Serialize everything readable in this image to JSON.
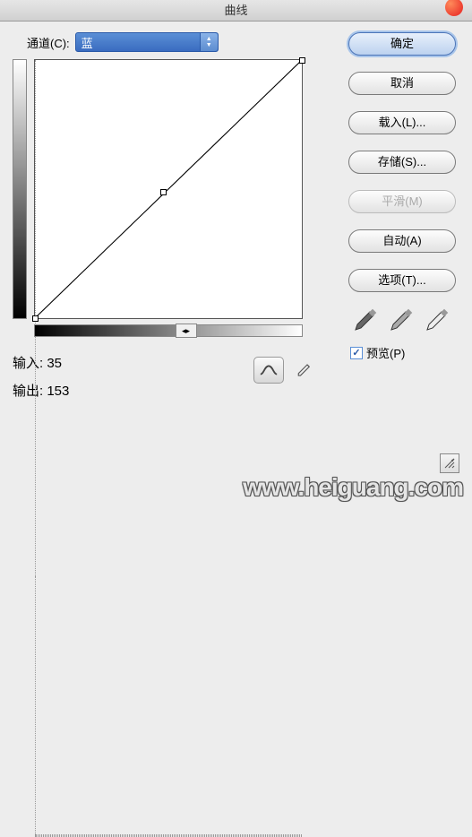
{
  "title": "曲线",
  "channel": {
    "label": "通道(C):",
    "value": "蓝"
  },
  "io": {
    "input_label": "输入:",
    "input_value": "35",
    "output_label": "输出:",
    "output_value": "153"
  },
  "buttons": {
    "ok": "确定",
    "cancel": "取消",
    "load": "载入(L)...",
    "save": "存储(S)...",
    "smooth": "平滑(M)",
    "auto": "自动(A)",
    "options": "选项(T)..."
  },
  "preview": {
    "label": "预览(P)",
    "checked": true
  },
  "hslider_glyph": "◂▸",
  "watermark": "www.heiguang.com",
  "chart_data": {
    "type": "line",
    "title": "",
    "xlabel": "",
    "ylabel": "",
    "xlim": [
      0,
      255
    ],
    "ylim": [
      0,
      255
    ],
    "grid": true,
    "series": [
      {
        "name": "curve",
        "x": [
          0,
          128,
          255
        ],
        "y": [
          0,
          128,
          255
        ]
      }
    ],
    "handles": [
      {
        "x": 0,
        "y": 0
      },
      {
        "x": 122,
        "y": 124
      },
      {
        "x": 255,
        "y": 255
      }
    ]
  }
}
